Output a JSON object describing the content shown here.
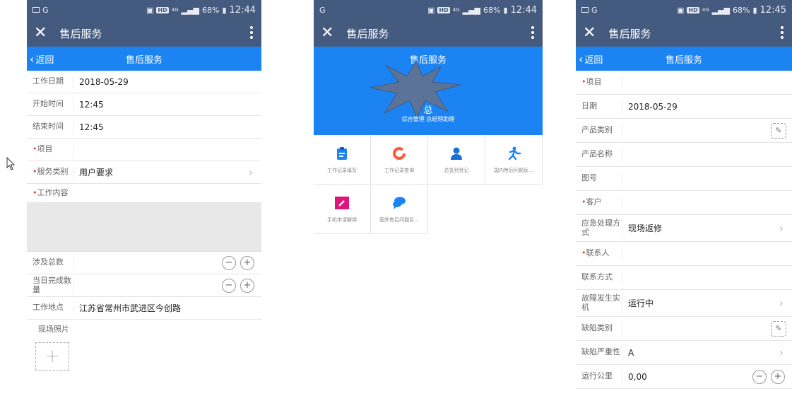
{
  "status": {
    "p1": {
      "time": "12:44",
      "battery": "68%",
      "hd": "HD",
      "net": "4G"
    },
    "p2": {
      "time": "12:44",
      "battery": "68%",
      "hd": "HD",
      "net": "4G"
    },
    "p3": {
      "time": "12:45",
      "battery": "68%",
      "hd": "HD",
      "net": "4G"
    }
  },
  "app": {
    "title": "售后服务",
    "close": "✕",
    "back": "返回",
    "nav_title": "售后服务"
  },
  "form1": {
    "work_date_label": "工作日期",
    "work_date": "2018-05-29",
    "start_label": "开始时间",
    "start": "12:45",
    "end_label": "结束时间",
    "end": "12:45",
    "project_label": "项目",
    "service_type_label": "服务类别",
    "service_type": "用户要求",
    "content_label": "工作内容",
    "total_label": "涉及总数",
    "done_label": "当日完成数量",
    "location_label": "工作地点",
    "location": "江苏省常州市武进区今创路",
    "photo_label": "现场照片"
  },
  "home": {
    "banner_title": "售后服务",
    "user_name": "总",
    "user_role": "综合管理 总经理助理",
    "tiles": [
      {
        "label": "工作记录填写",
        "icon": "clipboard-icon",
        "color": "#1c84f2"
      },
      {
        "label": "工作记录查询",
        "icon": "ring-icon",
        "color": "#ff5a36"
      },
      {
        "label": "总签到登记",
        "icon": "person-icon",
        "color": "#1c6fd1"
      },
      {
        "label": "国内售后问题反...",
        "icon": "runner-icon",
        "color": "#1c84f2"
      },
      {
        "label": "手机申请解绑",
        "icon": "edit-icon",
        "color": "#e0157a"
      },
      {
        "label": "国外售后问题反...",
        "icon": "chat-icon",
        "color": "#1c84f2"
      }
    ]
  },
  "form3": {
    "project_label": "项目",
    "date_label": "日期",
    "date": "2018-05-29",
    "product_type_label": "产品类别",
    "product_name_label": "产品名称",
    "drawing_label": "图号",
    "customer_label": "客户",
    "emergency_label": "应急处理方式",
    "emergency": "现场返修",
    "contact_label": "联系人",
    "contact_method_label": "联系方式",
    "fault_time_label": "故障发生实机",
    "fault_time": "运行中",
    "defect_type_label": "缺陷类别",
    "severity_label": "缺陷严重性",
    "severity": "A",
    "mileage_label": "运行公里",
    "mileage": "0,00"
  }
}
